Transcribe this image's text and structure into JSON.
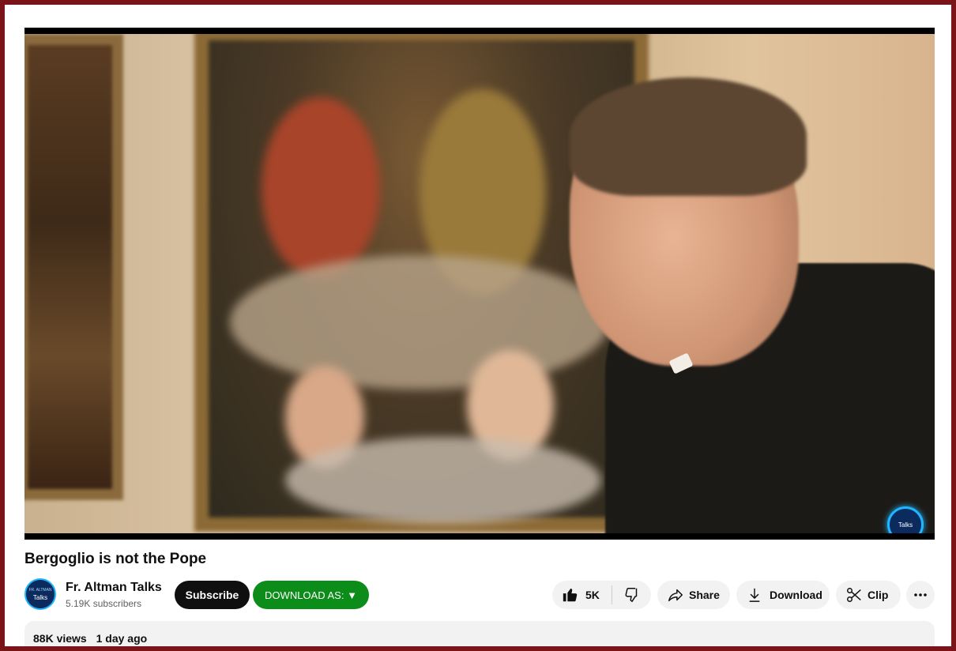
{
  "video": {
    "title": "Bergoglio is not the Pope",
    "watermark_logo_text": "Talks"
  },
  "channel": {
    "name": "Fr. Altman Talks",
    "subscribers": "5.19K subscribers",
    "avatar_text": "Talks",
    "avatar_small_text": "FR. ALTMAN"
  },
  "buttons": {
    "subscribe": "Subscribe",
    "download_as": "DOWNLOAD AS: ▼",
    "likes": "5K",
    "share": "Share",
    "download": "Download",
    "clip": "Clip"
  },
  "description": {
    "views": "88K views",
    "age": "1 day ago"
  },
  "colors": {
    "border": "#7a1418",
    "subscribe_bg": "#0f0f0f",
    "download_as_bg": "#0c8c19",
    "pill_bg": "#f2f2f2"
  },
  "icons": [
    "thumbs-up-icon",
    "thumbs-down-icon",
    "share-icon",
    "download-icon",
    "scissors-icon",
    "more-icon"
  ]
}
